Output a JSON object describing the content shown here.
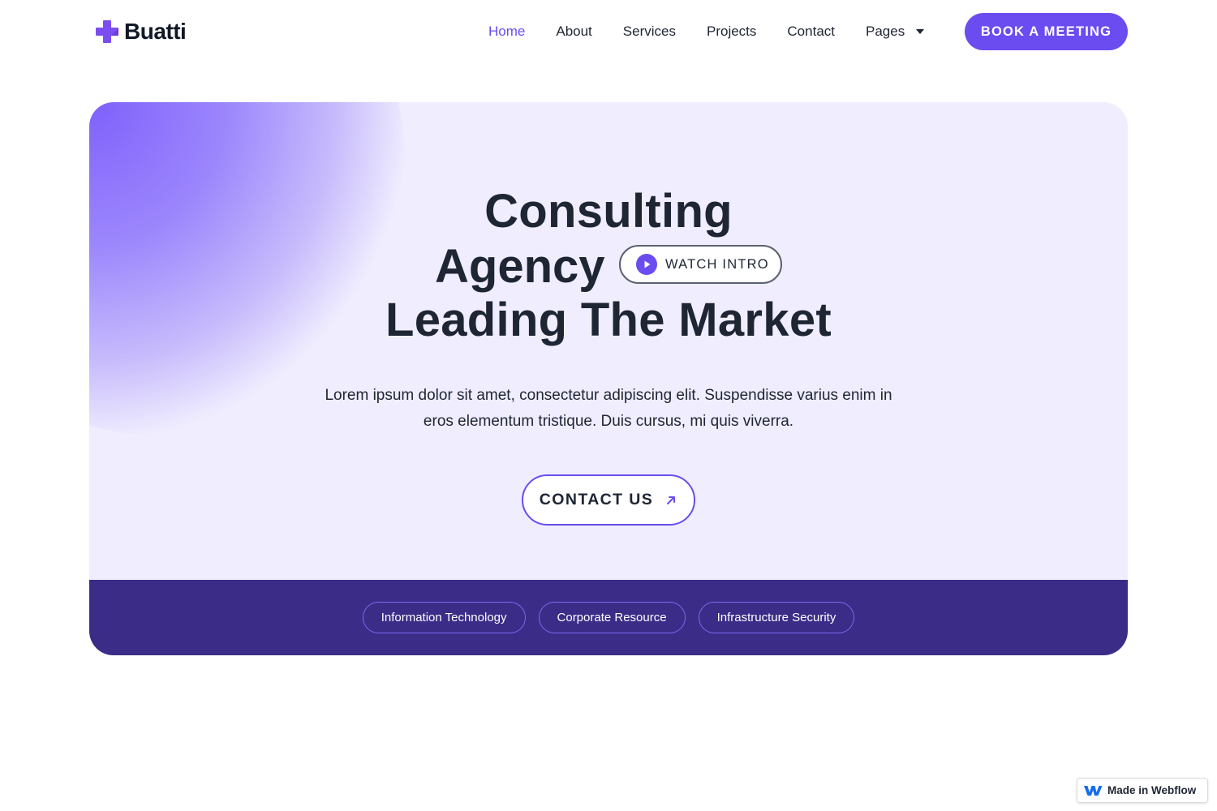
{
  "colors": {
    "accent": "#6a4cf0",
    "hero_background": "#f0edfe",
    "band_background": "#3b2c87",
    "text_dark": "#1e2533"
  },
  "header": {
    "logo_icon": "plus-cross-icon",
    "logo_text": "Buatti",
    "nav": [
      {
        "label": "Home",
        "active": true
      },
      {
        "label": "About",
        "active": false
      },
      {
        "label": "Services",
        "active": false
      },
      {
        "label": "Projects",
        "active": false
      },
      {
        "label": "Contact",
        "active": false
      }
    ],
    "pages_label": "Pages",
    "pages_icon": "caret-down-icon",
    "cta_label": "BOOK A MEETING"
  },
  "hero": {
    "headline_line1": "Consulting",
    "headline_line2": "Agency",
    "headline_line3": "Leading The Market",
    "watch_label": "WATCH INTRO",
    "watch_icon": "play-icon",
    "description": "Lorem ipsum dolor sit amet, consectetur adipiscing elit. Suspendisse varius enim in eros elementum tristique. Duis cursus, mi quis viverra.",
    "contact_label": "CONTACT US",
    "contact_icon": "arrow-up-right-icon"
  },
  "tags": [
    "Information Technology",
    "Corporate Resource",
    "Infrastructure Security"
  ],
  "badge": {
    "icon": "webflow-logo-icon",
    "label": "Made in Webflow"
  }
}
